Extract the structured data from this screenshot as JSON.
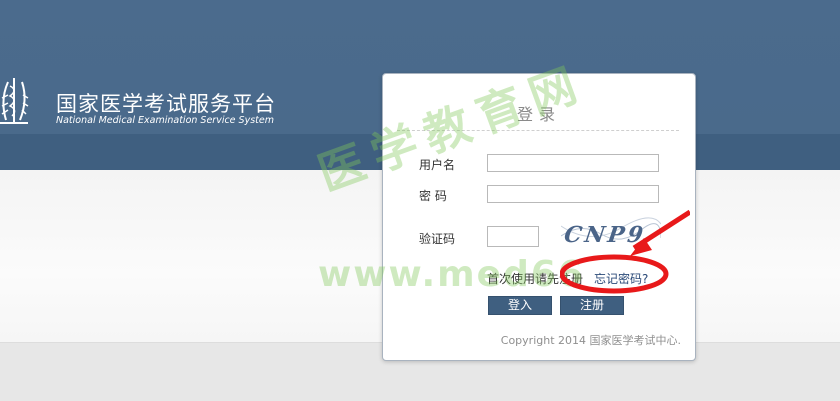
{
  "brand": {
    "title_cn": "国家医学考试服务平台",
    "title_en": "National Medical Examination Service System",
    "emblem_icon": "medical-caduceus-emblem-icon"
  },
  "login": {
    "title": "登录",
    "username_label": "用户名",
    "username_value": "",
    "password_label": "密 码",
    "password_value": "",
    "captcha_label": "验证码",
    "captcha_value": "",
    "captcha_text": "CNP9",
    "first_use_text": "首次使用请先注册",
    "forgot_password_link": "忘记密码?",
    "login_button": "登入",
    "register_button": "注册",
    "copyright": "Copyright 2014 国家医学考试中心."
  },
  "watermark": {
    "cn": "医学教育网",
    "url": "www.med66"
  },
  "colors": {
    "header": "#4a6a8b",
    "header_band": "#3f5f80",
    "button": "#3f5f80",
    "annotation": "#e8191a",
    "watermark": "#82c85a"
  }
}
